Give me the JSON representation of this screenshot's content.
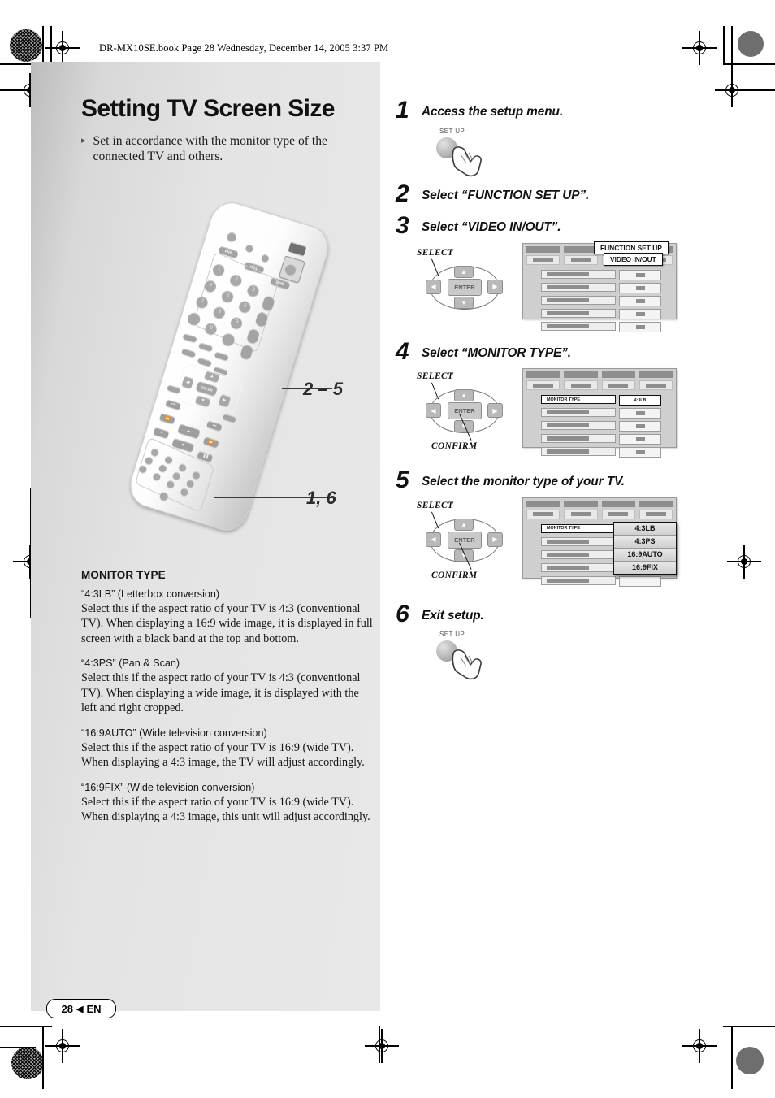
{
  "header": {
    "running_head": "DR-MX10SE.book  Page 28  Wednesday, December 14, 2005  3:37 PM"
  },
  "page": {
    "title": "Setting TV Screen Size",
    "lead_bullet": "▸",
    "lead": "Set in accordance with the monitor type of the connected TV and others."
  },
  "remote": {
    "callout_upper": "2 – 5",
    "callout_lower": "1, 6",
    "source_labels": [
      "VHS",
      "HDD",
      "DVD"
    ],
    "keys": [
      "1",
      "2",
      "3",
      "4",
      "5",
      "6",
      "7",
      "8",
      "9",
      "0"
    ],
    "enter_label": "ENTER"
  },
  "monitor_type": {
    "heading": "MONITOR TYPE",
    "items": [
      {
        "term": "“4:3LB” (Letterbox conversion)",
        "desc": "Select this if the aspect ratio of your TV is 4:3 (conventional TV). When displaying a 16:9 wide image, it is displayed in full screen with a black band at the top and bottom."
      },
      {
        "term": "“4:3PS” (Pan & Scan)",
        "desc": "Select this if the aspect ratio of your TV is 4:3 (conventional TV). When displaying a wide image, it is displayed with the left and right cropped."
      },
      {
        "term": "“16:9AUTO” (Wide television conversion)",
        "desc": "Select this if the aspect ratio of your TV is 16:9 (wide TV). When displaying a 4:3 image, the TV will adjust accordingly."
      },
      {
        "term": "“16:9FIX” (Wide television conversion)",
        "desc": "Select this if the aspect ratio of your TV is 16:9 (wide TV). When displaying a 4:3 image, this unit will adjust accordingly."
      }
    ]
  },
  "steps": [
    {
      "num": "1",
      "text": "Access the setup menu."
    },
    {
      "num": "2",
      "text": "Select “FUNCTION SET UP”."
    },
    {
      "num": "3",
      "text": "Select “VIDEO IN/OUT”."
    },
    {
      "num": "4",
      "text": "Select “MONITOR TYPE”."
    },
    {
      "num": "5",
      "text": "Select the monitor type of your TV."
    },
    {
      "num": "6",
      "text": "Exit setup."
    }
  ],
  "graphics": {
    "setup_button_label": "SET UP",
    "select_label": "SELECT",
    "confirm_label": "CONFIRM",
    "enter_label": "ENTER",
    "arrow_up": "▲",
    "arrow_down": "▼",
    "arrow_left": "◀",
    "arrow_right": "▶"
  },
  "osd": {
    "popup_function_set_up": "FUNCTION SET UP",
    "popup_video_in_out": "VIDEO IN/OUT",
    "monitor_type_label": "MONITOR TYPE",
    "monitor_type_value": "4:3LB",
    "dropdown_options": [
      "4:3LB",
      "4:3PS",
      "16:9AUTO",
      "16:9FIX"
    ]
  },
  "footer": {
    "page_number": "28",
    "arrow": "◀",
    "lang": "EN"
  }
}
